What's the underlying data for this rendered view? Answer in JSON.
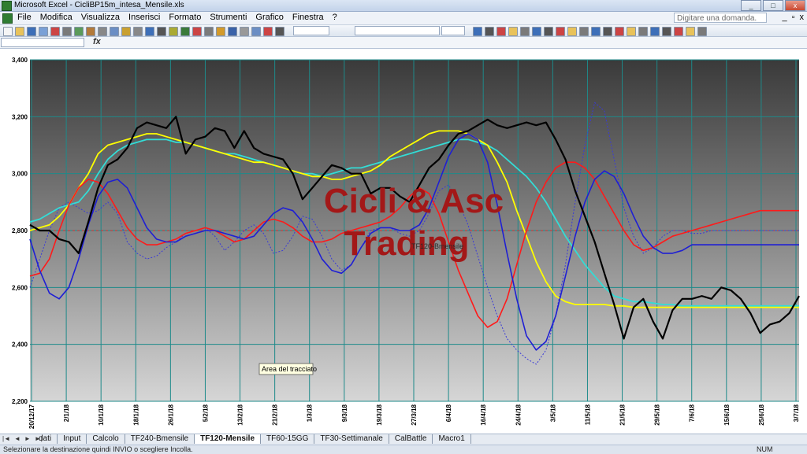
{
  "window": {
    "title": "Microsoft Excel - CicliBP15m_intesa_Mensile.xls",
    "btn_min": "_",
    "btn_max": "□",
    "btn_close": "x"
  },
  "menu": {
    "items": [
      "File",
      "Modifica",
      "Visualizza",
      "Inserisci",
      "Formato",
      "Strumenti",
      "Grafico",
      "Finestra",
      "?"
    ],
    "help_placeholder": "Digitare una domanda.",
    "ctrl_min": "_",
    "ctrl_restore": "▫",
    "ctrl_close": "x"
  },
  "formula_bar": {
    "fx_label": "fx"
  },
  "chart_data": {
    "type": "line",
    "title": "",
    "watermark_line1": "Cicli & Asc",
    "watermark_line2": "Trading",
    "series_label_on_plot": "TF120-Bmensile",
    "tooltip": "Area del tracciato",
    "ylim": [
      2200,
      3400
    ],
    "y_ticks": [
      "3,400",
      "3,200",
      "3,000",
      "2,800",
      "2,600",
      "2,400",
      "2,200"
    ],
    "y_tick_values": [
      3400,
      3200,
      3000,
      2800,
      2600,
      2400,
      2200
    ],
    "x_labels": [
      "20/12/17",
      "2/1/18",
      "10/1/18",
      "18/1/18",
      "26/1/18",
      "5/2/18",
      "13/2/18",
      "21/2/18",
      "1/3/18",
      "9/3/18",
      "19/3/18",
      "27/3/18",
      "6/4/18",
      "16/4/18",
      "24/4/18",
      "3/5/18",
      "11/5/18",
      "21/5/18",
      "29/5/18",
      "7/6/18",
      "15/6/18",
      "25/6/18",
      "3/7/18"
    ],
    "reference_line": 2800,
    "colors": {
      "price": "#000000",
      "cyan": "#33dcd6",
      "yellow": "#ffff00",
      "red": "#ff1a1a",
      "blue": "#1f1fd4",
      "dotted_blue": "#3a3ad8",
      "reference": "#c83232",
      "watermark": "#a31818"
    },
    "series": [
      {
        "key": "price",
        "values": [
          2820,
          2800,
          2800,
          2770,
          2760,
          2720,
          2830,
          2950,
          3030,
          3050,
          3090,
          3160,
          3180,
          3170,
          3160,
          3200,
          3070,
          3120,
          3130,
          3160,
          3150,
          3090,
          3150,
          3090,
          3070,
          3060,
          3050,
          3000,
          2910,
          2950,
          2990,
          3030,
          3020,
          3000,
          3000,
          2930,
          2950,
          2950,
          2920,
          2900,
          2960,
          3020,
          3050,
          3100,
          3140,
          3150,
          3170,
          3190,
          3170,
          3160,
          3170,
          3180,
          3170,
          3180,
          3120,
          3050,
          2940,
          2850,
          2760,
          2650,
          2540,
          2420,
          2530,
          2560,
          2480,
          2420,
          2520,
          2560,
          2560,
          2570,
          2560,
          2600,
          2590,
          2560,
          2510,
          2440,
          2470,
          2480,
          2510,
          2570
        ]
      },
      {
        "key": "cyan",
        "values": [
          2830,
          2840,
          2860,
          2880,
          2890,
          2900,
          2940,
          3000,
          3050,
          3080,
          3100,
          3110,
          3120,
          3120,
          3120,
          3110,
          3110,
          3100,
          3090,
          3080,
          3070,
          3070,
          3060,
          3050,
          3040,
          3030,
          3020,
          3010,
          3000,
          3000,
          2990,
          3000,
          3010,
          3020,
          3020,
          3030,
          3040,
          3050,
          3060,
          3070,
          3080,
          3090,
          3100,
          3110,
          3120,
          3120,
          3110,
          3100,
          3080,
          3050,
          3020,
          2990,
          2950,
          2900,
          2840,
          2780,
          2730,
          2680,
          2640,
          2600,
          2570,
          2560,
          2550,
          2550,
          2545,
          2540,
          2540,
          2535,
          2535,
          2535,
          2535,
          2535,
          2535,
          2535,
          2535,
          2535,
          2535,
          2535,
          2535,
          2535
        ]
      },
      {
        "key": "yellow",
        "values": [
          2800,
          2810,
          2820,
          2850,
          2890,
          2950,
          3000,
          3070,
          3100,
          3110,
          3120,
          3130,
          3140,
          3140,
          3130,
          3120,
          3110,
          3100,
          3090,
          3080,
          3070,
          3060,
          3050,
          3040,
          3040,
          3030,
          3020,
          3010,
          3000,
          2990,
          2990,
          2980,
          2980,
          2990,
          3000,
          3010,
          3030,
          3060,
          3080,
          3100,
          3120,
          3140,
          3150,
          3150,
          3150,
          3140,
          3120,
          3100,
          3040,
          2970,
          2870,
          2780,
          2690,
          2620,
          2570,
          2550,
          2540,
          2540,
          2540,
          2540,
          2535,
          2535,
          2530,
          2530,
          2530,
          2530,
          2530,
          2530,
          2530,
          2530,
          2530,
          2530,
          2530,
          2530,
          2530,
          2530,
          2530,
          2530,
          2530,
          2530
        ]
      },
      {
        "key": "red",
        "values": [
          2640,
          2650,
          2700,
          2800,
          2890,
          2950,
          2980,
          2970,
          2930,
          2870,
          2810,
          2770,
          2750,
          2750,
          2760,
          2770,
          2790,
          2800,
          2810,
          2800,
          2780,
          2760,
          2770,
          2800,
          2830,
          2840,
          2830,
          2810,
          2780,
          2760,
          2760,
          2770,
          2790,
          2800,
          2810,
          2820,
          2830,
          2850,
          2880,
          2920,
          2950,
          2930,
          2860,
          2760,
          2660,
          2580,
          2500,
          2460,
          2480,
          2560,
          2680,
          2800,
          2900,
          2970,
          3020,
          3040,
          3040,
          3020,
          2980,
          2920,
          2860,
          2800,
          2750,
          2730,
          2740,
          2760,
          2780,
          2790,
          2800,
          2810,
          2820,
          2830,
          2840,
          2850,
          2860,
          2870,
          2870,
          2870,
          2870,
          2870
        ]
      },
      {
        "key": "blue",
        "values": [
          2770,
          2660,
          2580,
          2560,
          2600,
          2700,
          2820,
          2920,
          2970,
          2980,
          2950,
          2880,
          2810,
          2770,
          2760,
          2760,
          2780,
          2790,
          2800,
          2800,
          2790,
          2780,
          2770,
          2780,
          2820,
          2860,
          2880,
          2870,
          2830,
          2770,
          2700,
          2660,
          2650,
          2680,
          2740,
          2790,
          2810,
          2810,
          2800,
          2800,
          2820,
          2880,
          2970,
          3060,
          3120,
          3140,
          3120,
          3040,
          2890,
          2720,
          2560,
          2430,
          2380,
          2410,
          2500,
          2640,
          2780,
          2900,
          2980,
          3010,
          2990,
          2930,
          2850,
          2780,
          2740,
          2720,
          2720,
          2730,
          2750,
          2750,
          2750,
          2750,
          2750,
          2750,
          2750,
          2750,
          2750,
          2750,
          2750,
          2750
        ]
      },
      {
        "key": "dotted_blue",
        "values": [
          2600,
          2700,
          2800,
          2880,
          2900,
          2880,
          2860,
          2870,
          2900,
          2860,
          2760,
          2720,
          2700,
          2710,
          2740,
          2760,
          2790,
          2800,
          2810,
          2780,
          2730,
          2760,
          2800,
          2820,
          2790,
          2720,
          2730,
          2780,
          2850,
          2840,
          2780,
          2700,
          2660,
          2680,
          2740,
          2800,
          2810,
          2810,
          2790,
          2780,
          2800,
          2860,
          2940,
          2960,
          2900,
          2820,
          2710,
          2600,
          2500,
          2420,
          2380,
          2350,
          2330,
          2380,
          2500,
          2680,
          2900,
          3100,
          3250,
          3220,
          3050,
          2880,
          2780,
          2720,
          2740,
          2780,
          2800,
          2800,
          2790,
          2790,
          2800,
          2800,
          2800,
          2800,
          2800,
          2800,
          2800,
          2800,
          2800,
          2800
        ]
      }
    ]
  },
  "sheet_tabs": {
    "nav": [
      "|◄",
      "◄",
      "►",
      "►|"
    ],
    "items": [
      "dati",
      "Input",
      "Calcolo",
      "TF240-Bmensile",
      "TF120-Mensile",
      "TF60-15GG",
      "TF30-Settimanale",
      "CalBattle",
      "Macro1"
    ],
    "active_index": 4
  },
  "status": {
    "text": "Selezionare la destinazione quindi INVIO o scegliere Incolla.",
    "num": "NUM"
  }
}
